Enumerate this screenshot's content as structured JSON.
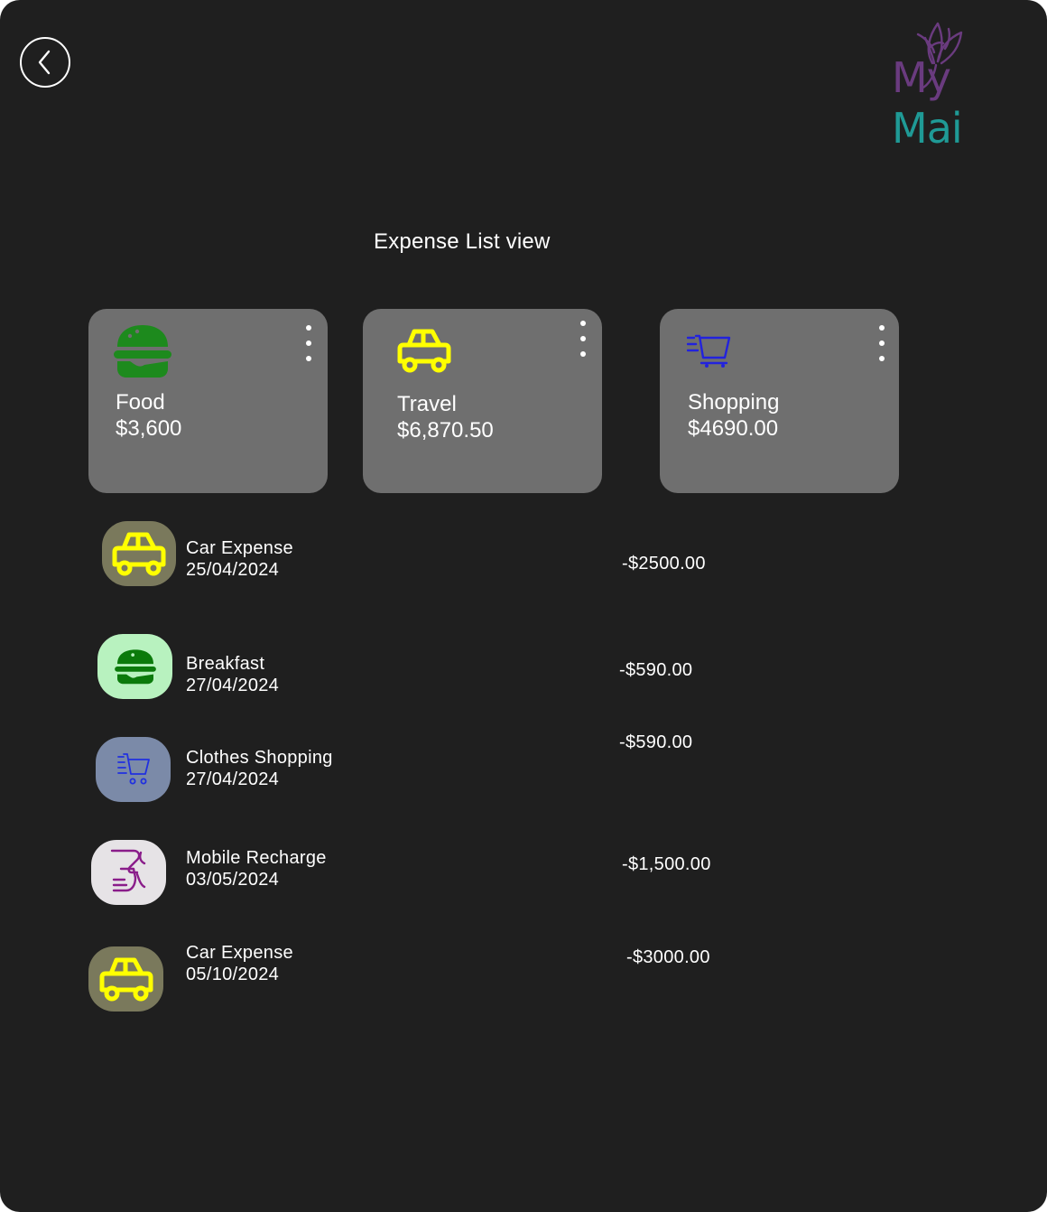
{
  "header": {
    "back_icon": "chevron-left-icon",
    "logo": {
      "part1": "My",
      "part2": "Mai",
      "colors": {
        "my": "#6a3b7f",
        "mai": "#1f9a96"
      }
    }
  },
  "page_title": "Expense List view",
  "categories": [
    {
      "name": "Food",
      "amount": "$3,600",
      "icon": "burger-icon",
      "icon_color": "#1d8a1d"
    },
    {
      "name": "Travel",
      "amount": "$6,870.50",
      "icon": "car-icon",
      "icon_color": "#ffff00"
    },
    {
      "name": "Shopping",
      "amount": "$4690.00",
      "icon": "shopping-cart-icon",
      "icon_color": "#2222dd"
    }
  ],
  "transactions": [
    {
      "title": "Car Expense",
      "date": "25/04/2024",
      "amount": "-$2500.00",
      "icon": "car-icon",
      "icon_bg": "#7a795c",
      "icon_color": "#ffff00"
    },
    {
      "title": "Breakfast",
      "date": "27/04/2024",
      "amount": "-$590.00",
      "icon": "burger-icon",
      "icon_bg": "#b8f2bf",
      "icon_color": "#0b7a0b"
    },
    {
      "title": "Clothes Shopping",
      "date": "27/04/2024",
      "amount": "-$590.00",
      "icon": "shopping-cart-icon",
      "icon_bg": "#7b8aa8",
      "icon_color": "#2030e0"
    },
    {
      "title": "Mobile Recharge",
      "date": "03/05/2024",
      "amount": "-$1,500.00",
      "icon": "mobile-recharge-icon",
      "icon_bg": "#e6e3e6",
      "icon_color": "#8a1d8a"
    },
    {
      "title": "Car Expense",
      "date": "05/10/2024",
      "amount": "-$3000.00",
      "icon": "car-icon",
      "icon_bg": "#7a795c",
      "icon_color": "#ffff00"
    }
  ],
  "colors": {
    "background": "#1f1f1f",
    "card": "#6f6f6f",
    "text": "#ffffff"
  }
}
